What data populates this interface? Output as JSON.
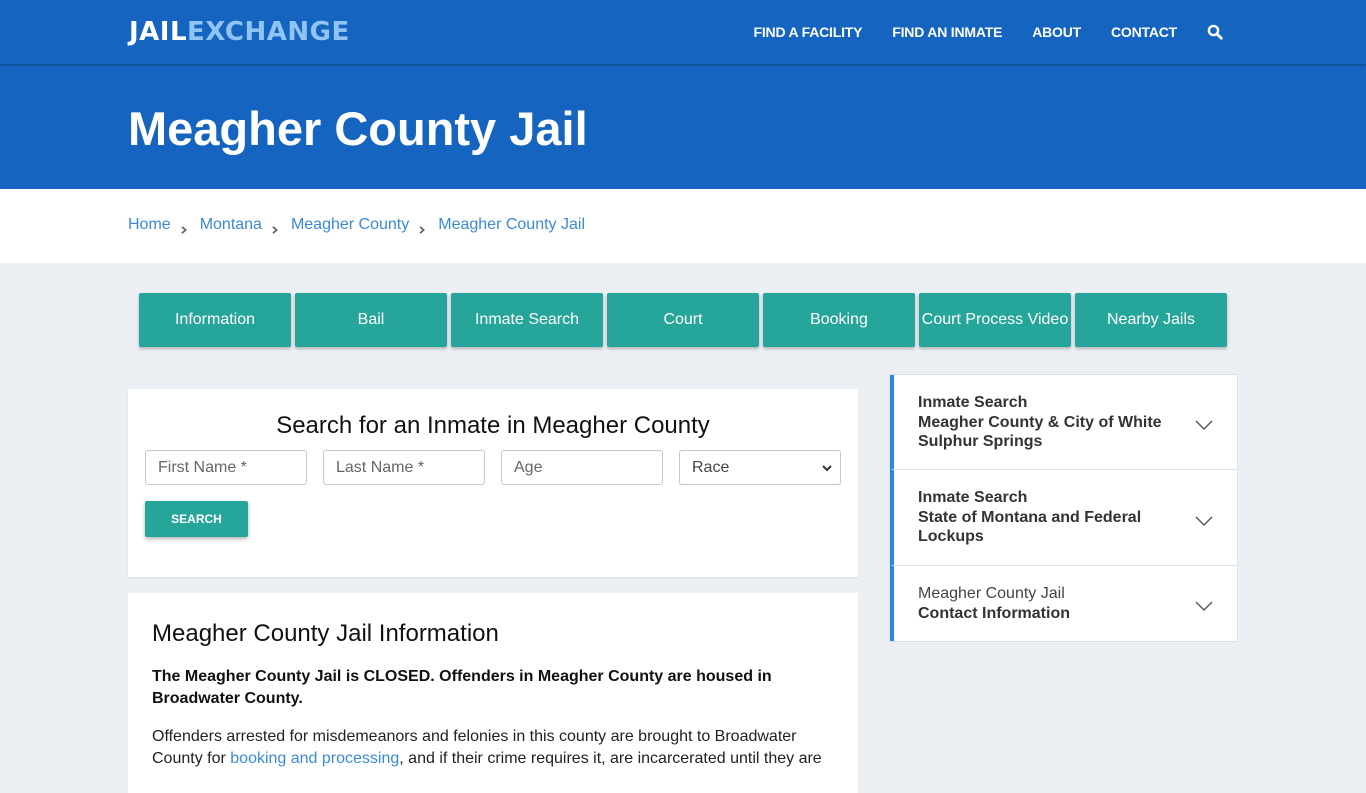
{
  "brand": {
    "part1": "JAIL",
    "part2": "EXCHANGE"
  },
  "nav": {
    "links": [
      "FIND A FACILITY",
      "FIND AN INMATE",
      "ABOUT",
      "CONTACT"
    ],
    "search_icon": "search-icon"
  },
  "hero": {
    "title": "Meagher County Jail"
  },
  "breadcrumb": [
    "Home",
    "Montana",
    "Meagher County",
    "Meagher County Jail"
  ],
  "tabs": [
    "Information",
    "Bail",
    "Inmate Search",
    "Court",
    "Booking",
    "Court Process Video",
    "Nearby Jails"
  ],
  "search_form": {
    "title": "Search for an Inmate in Meagher County",
    "first_name_placeholder": "First Name *",
    "last_name_placeholder": "Last Name *",
    "age_placeholder": "Age",
    "race_selected": "Race",
    "submit_label": "SEARCH"
  },
  "info": {
    "heading": "Meagher County Jail Information",
    "bold_notice": "The Meagher County Jail is CLOSED.  Offenders in Meagher County are housed in Broadwater County.",
    "para_before_link": "Offenders arrested for misdemeanors and felonies in this county are brought to Broadwater County for ",
    "link_text": "booking and processing",
    "para_after_link": ", and if their crime requires it, are incarcerated until they are"
  },
  "sidebar": {
    "items": [
      {
        "line1": "Inmate Search",
        "line2": "Meagher County & City of White Sulphur Springs",
        "line1_bold": true
      },
      {
        "line1": "Inmate Search",
        "line2": "State of Montana and Federal Lockups",
        "line1_bold": true
      },
      {
        "line1": "Meagher County Jail",
        "line2": "Contact Information",
        "line1_bold": false
      }
    ]
  },
  "colors": {
    "primary_blue": "#1565c0",
    "logo_accent": "#90c4f5",
    "teal": "#26a69a",
    "link_blue": "#3b8ad8",
    "page_bg": "#eceff3"
  }
}
